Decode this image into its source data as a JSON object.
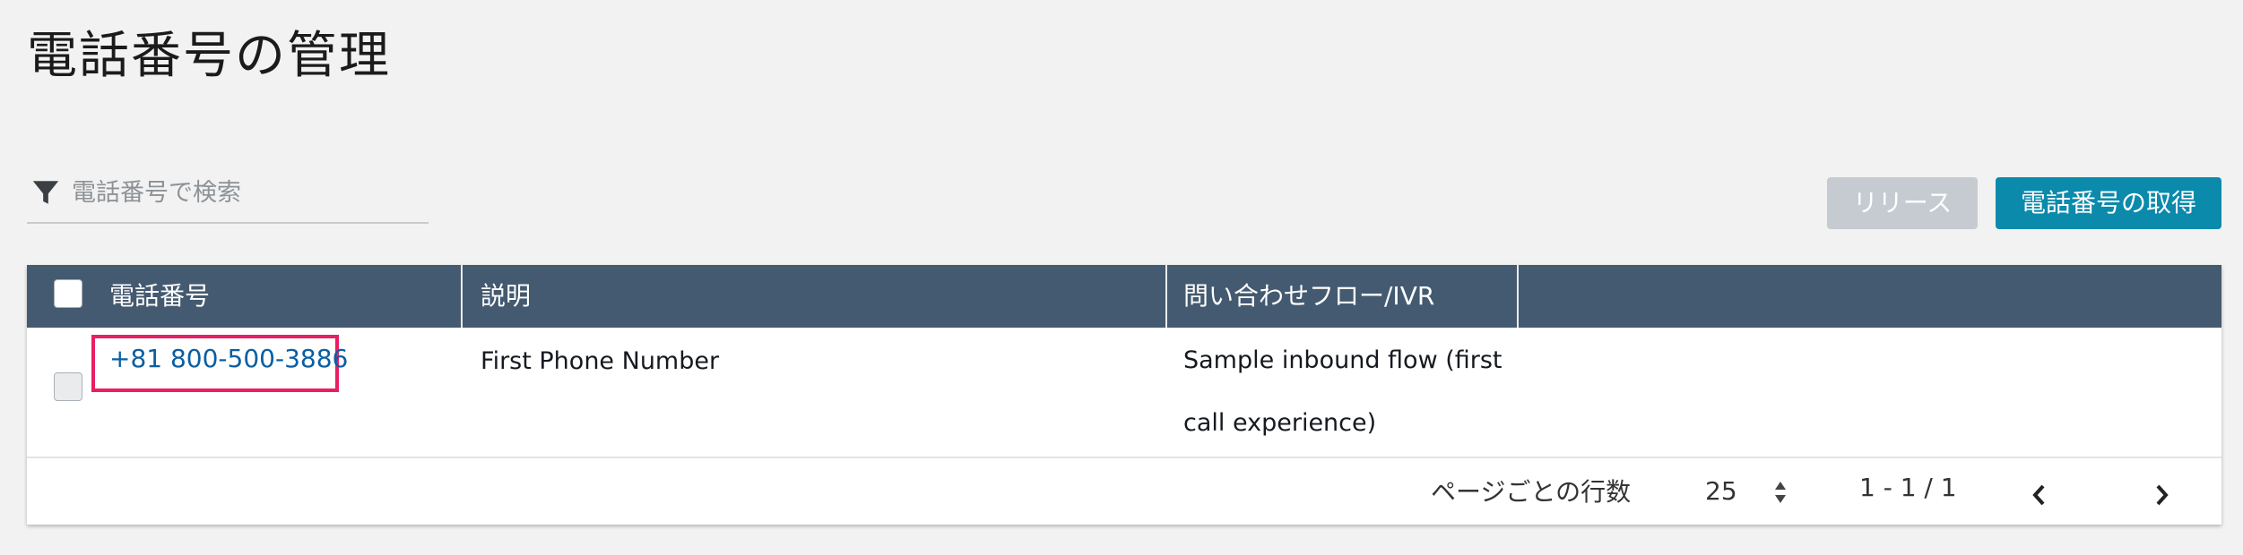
{
  "page": {
    "title": "電話番号の管理"
  },
  "search": {
    "placeholder": "電話番号で検索",
    "value": ""
  },
  "toolbar": {
    "release_label": "リリース",
    "acquire_label": "電話番号の取得"
  },
  "table": {
    "columns": [
      "電話番号",
      "説明",
      "問い合わせフロー/IVR"
    ],
    "rows": [
      {
        "phone": "+81 800-500-3886",
        "description": "First Phone Number",
        "flow": "Sample inbound flow (first call experience)"
      }
    ]
  },
  "pagination": {
    "rows_per_page_label": "ページごとの行数",
    "rows_per_page": "25",
    "range": "1 - 1 / 1"
  },
  "colors": {
    "header_bg": "#445a70",
    "primary_button": "#0b8aab",
    "disabled_button": "#c6cbd1",
    "link": "#0a5fa3",
    "highlight_box": "#e91e63"
  },
  "icons": [
    "filter-icon",
    "sort-arrows-icon",
    "chevron-left-icon",
    "chevron-right-icon"
  ]
}
